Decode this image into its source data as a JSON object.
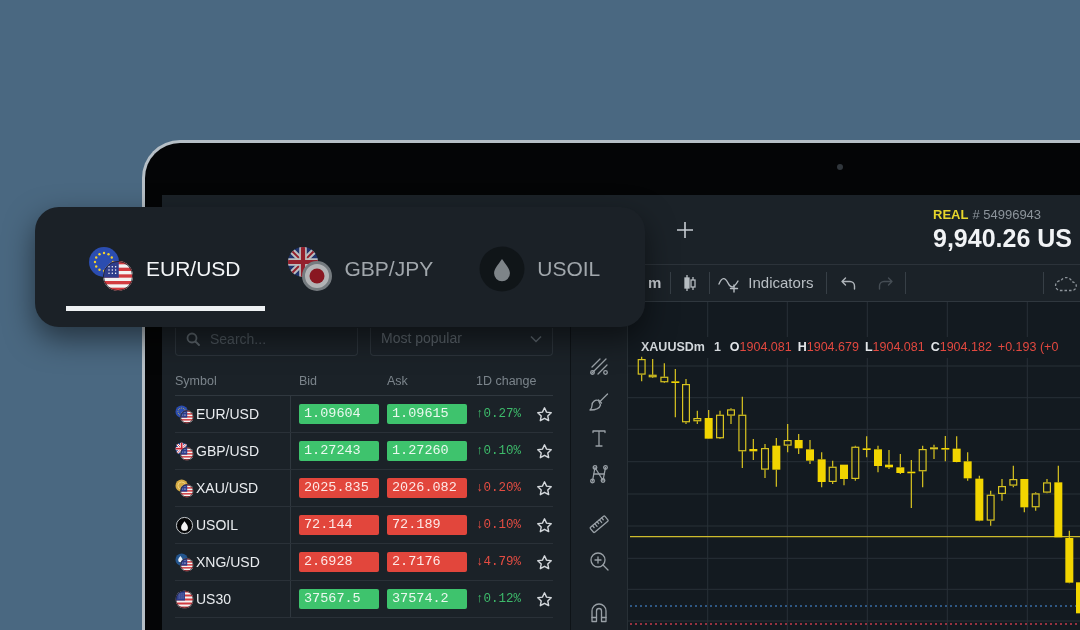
{
  "tabs": [
    {
      "label": "EUR/USD",
      "selected": true
    },
    {
      "label": "GBP/JPY",
      "selected": false
    },
    {
      "label": "USOIL",
      "selected": false
    }
  ],
  "account": {
    "type": "REAL",
    "number": "# 54996943",
    "balance": "9,940.26 US"
  },
  "chart_toolbar": {
    "timeframe": "m",
    "indicators": "Indicators",
    "undo": {
      "disabled": false
    },
    "redo": {
      "disabled": true
    }
  },
  "watchlist": {
    "search": {
      "placeholder": "Search..."
    },
    "filter": {
      "value": "Most popular"
    },
    "columns": [
      "Symbol",
      "Bid",
      "Ask",
      "1D change"
    ],
    "rows": [
      {
        "symbol": "EUR/USD",
        "bid": "1.09604",
        "ask": "1.09615",
        "change": "↑0.27%",
        "rising": true,
        "favorite": false
      },
      {
        "symbol": "GBP/USD",
        "bid": "1.27243",
        "ask": "1.27260",
        "change": "↑0.10%",
        "rising": true,
        "favorite": false
      },
      {
        "symbol": "XAU/USD",
        "bid": "2025.835",
        "ask": "2026.082",
        "change": "↓0.20%",
        "rising": false,
        "favorite": false
      },
      {
        "symbol": "USOIL",
        "bid": "72.144",
        "ask": "72.189",
        "change": "↓0.10%",
        "rising": false,
        "favorite": false
      },
      {
        "symbol": "XNG/USD",
        "bid": "2.6928",
        "ask": "2.7176",
        "change": "↓4.79%",
        "rising": false,
        "favorite": false
      },
      {
        "symbol": "US30",
        "bid": "37567.5",
        "ask": "37574.2",
        "change": "↑0.12%",
        "rising": true,
        "favorite": false
      }
    ]
  },
  "chart": {
    "legend": {
      "symbol": "XAUUSDm",
      "interval": "1",
      "values": [
        {
          "label": "O",
          "value": "1904.081"
        },
        {
          "label": "H",
          "value": "1904.679"
        },
        {
          "label": "L",
          "value": "1904.081"
        },
        {
          "label": "C",
          "value": "1904.182"
        }
      ],
      "change": "+0.193 (+0"
    }
  }
}
